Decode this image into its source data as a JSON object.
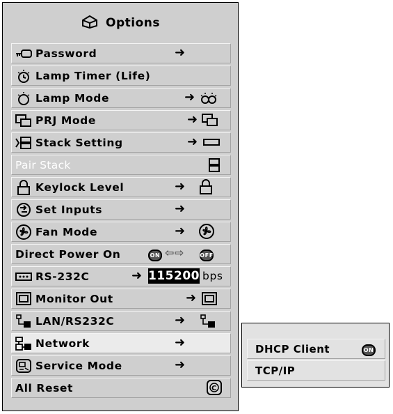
{
  "menu": {
    "title": "Options",
    "title_icon": "options-toolbox-icon",
    "items": [
      {
        "label": "Password",
        "icon": "key-icon",
        "arrow": "➜"
      },
      {
        "label": "Lamp Timer (Life)",
        "icon": "lamp-timer-icon"
      },
      {
        "label": "Lamp Mode",
        "icon": "lamp-icon",
        "arrow": "➜",
        "tail_icon": "lamp-mode-icon"
      },
      {
        "label": "PRJ Mode",
        "icon": "prj-mode-icon",
        "arrow": "➜",
        "tail_icon": "prj-mode-icon"
      },
      {
        "label": "Stack Setting",
        "icon": "stack-icon",
        "arrow": "➜",
        "tail_icon": "bar-icon"
      },
      {
        "label": "Pair Stack",
        "disabled": true,
        "tail_icon": "pair-stack-icon"
      },
      {
        "label": "Keylock Level",
        "icon": "padlock-icon",
        "arrow": "➜",
        "tail_icon": "padlock-icon"
      },
      {
        "label": "Set Inputs",
        "icon": "set-inputs-icon",
        "arrow": "➜"
      },
      {
        "label": "Fan Mode",
        "icon": "fan-icon",
        "arrow": "➜",
        "tail_icon": "fan-icon"
      },
      {
        "label": "Direct Power On",
        "on_badge": "ON",
        "off_badge": "OFF",
        "switch_arrows": "⇦⇨"
      },
      {
        "label": "RS-232C",
        "icon": "serial-port-icon",
        "arrow": "➜",
        "baud": "115200",
        "unit": "bps"
      },
      {
        "label": "Monitor Out",
        "icon": "monitor-icon",
        "arrow": "➜",
        "tail_icon": "monitor-icon"
      },
      {
        "label": "LAN/RS232C",
        "icon": "lan-icon",
        "arrow": "➜",
        "tail_icon": "lan-icon"
      },
      {
        "label": "Network",
        "icon": "network-icon",
        "arrow": "➜",
        "selected": true
      },
      {
        "label": "Service Mode",
        "icon": "service-icon",
        "arrow": "➜"
      },
      {
        "label": "All Reset",
        "tail_icon": "reset-icon",
        "tail_letter": "C"
      }
    ]
  },
  "submenu": {
    "items": [
      {
        "label": "DHCP Client",
        "badge": "ON"
      },
      {
        "label": "TCP/IP"
      }
    ]
  }
}
